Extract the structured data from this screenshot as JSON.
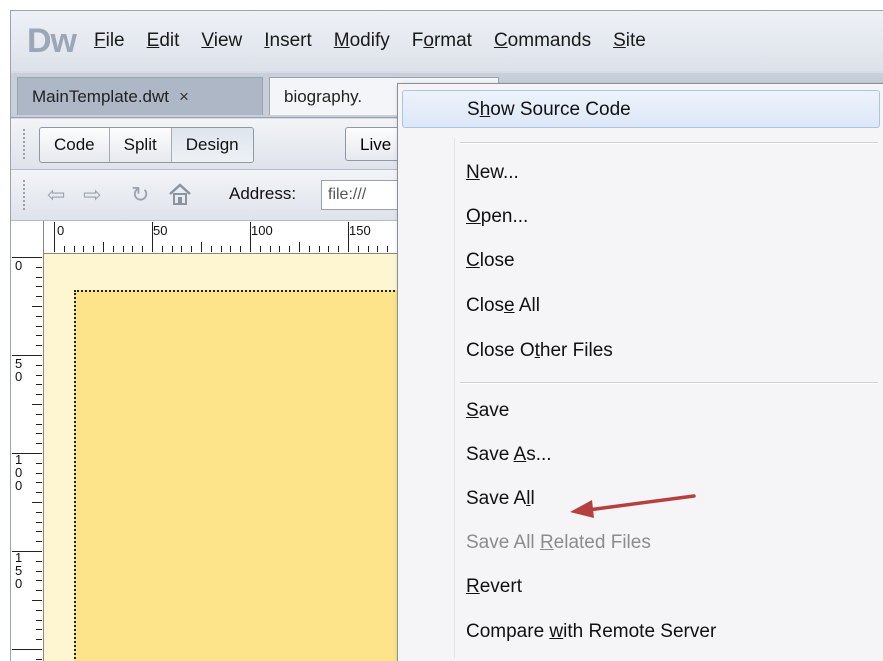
{
  "app": {
    "logo": "Dw"
  },
  "menubar": [
    {
      "pre": "",
      "key": "F",
      "post": "ile"
    },
    {
      "pre": "",
      "key": "E",
      "post": "dit"
    },
    {
      "pre": "",
      "key": "V",
      "post": "iew"
    },
    {
      "pre": "",
      "key": "I",
      "post": "nsert"
    },
    {
      "pre": "",
      "key": "M",
      "post": "odify"
    },
    {
      "pre": "F",
      "key": "o",
      "post": "rmat"
    },
    {
      "pre": "",
      "key": "C",
      "post": "ommands"
    },
    {
      "pre": "",
      "key": "S",
      "post": "ite"
    }
  ],
  "tabs": {
    "main": {
      "label": "MainTemplate.dwt",
      "close": "×"
    },
    "bio": {
      "label": "biography."
    }
  },
  "toolbar": {
    "code": "Code",
    "split": "Split",
    "design": "Design",
    "live": "Live"
  },
  "address": {
    "label": "Address:",
    "value": "file:///"
  },
  "ruler": {
    "h": [
      "0",
      "50",
      "100",
      "150"
    ],
    "v": [
      [
        "0"
      ],
      [
        "5",
        "0"
      ],
      [
        "1",
        "0",
        "0"
      ],
      [
        "1",
        "5",
        "0"
      ]
    ]
  },
  "context_menu": {
    "show_source": {
      "pre": "S",
      "key": "h",
      "post": "ow Source Code"
    },
    "new": {
      "pre": "",
      "key": "N",
      "post": "ew..."
    },
    "open": {
      "pre": "",
      "key": "O",
      "post": "pen..."
    },
    "close": {
      "pre": "",
      "key": "C",
      "post": "lose"
    },
    "close_all": {
      "pre": "Clos",
      "key": "e",
      "post": " All"
    },
    "close_other": {
      "pre": "Close O",
      "key": "t",
      "post": "her Files"
    },
    "save": {
      "pre": "",
      "key": "S",
      "post": "ave"
    },
    "save_as": {
      "pre": "Save ",
      "key": "A",
      "post": "s..."
    },
    "save_all": {
      "pre": "Save A",
      "key": "l",
      "post": "l"
    },
    "save_all_related": {
      "pre": "Save All ",
      "key": "R",
      "post": "elated Files"
    },
    "revert": {
      "pre": "",
      "key": "R",
      "post": "evert"
    },
    "compare": {
      "pre": "Compare ",
      "key": "w",
      "post": "ith Remote Server"
    }
  },
  "colors": {
    "annotation_arrow": "#b5403e",
    "page_fill": "#fde48a"
  }
}
